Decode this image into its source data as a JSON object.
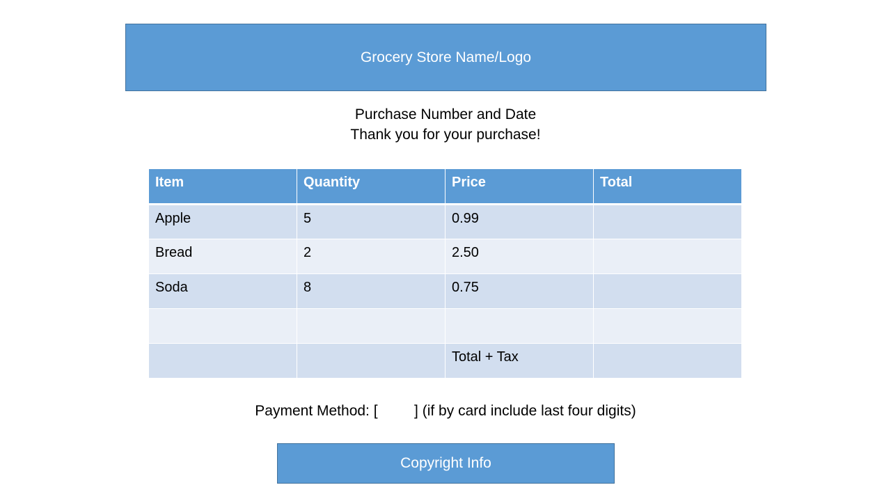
{
  "header": {
    "title": "Grocery Store Name/Logo"
  },
  "subheader": {
    "line1": "Purchase Number and Date",
    "line2": "Thank you for your purchase!"
  },
  "table": {
    "columns": [
      "Item",
      "Quantity",
      "Price",
      "Total"
    ],
    "rows": [
      [
        "Apple",
        "5",
        "0.99",
        ""
      ],
      [
        "Bread",
        "2",
        "2.50",
        ""
      ],
      [
        "Soda",
        "8",
        "0.75",
        ""
      ],
      [
        "",
        "",
        "",
        ""
      ],
      [
        "",
        "",
        "Total + Tax",
        ""
      ]
    ]
  },
  "payment": {
    "text": "Payment Method: [         ] (if by card include last four digits)"
  },
  "footer": {
    "text": "Copyright Info"
  },
  "colors": {
    "accent": "#5b9bd5",
    "accent_border": "#41719c",
    "row_dark": "#d2deef",
    "row_light": "#eaeff7"
  }
}
